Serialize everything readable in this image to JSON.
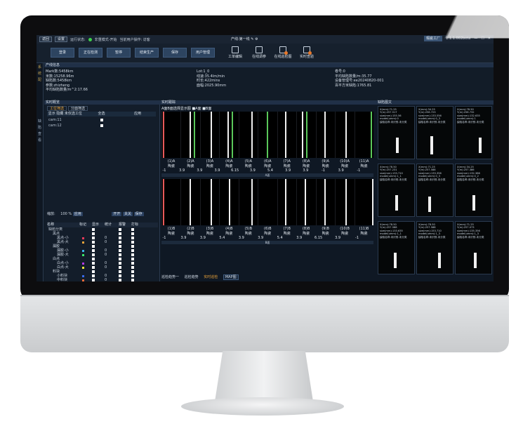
{
  "titlebar": {
    "btn_return": "返回",
    "btn_settings": "设置",
    "run_status_label": "运行状态:",
    "run_status_value": "非重模式-开始",
    "current_user": "当前用户操作: 访客",
    "line_name": "产线:第一线",
    "app_badge": "瑕疵工厂",
    "version": "1.1.1.002beta",
    "status_color": "#3ecf4a"
  },
  "toolbar": {
    "buttons": [
      "登录",
      "正在检测",
      "暂停",
      "结束生产",
      "保存",
      "用户管理"
    ],
    "icons": [
      {
        "label": "工单编辑",
        "icon": "edit-icon"
      },
      {
        "label": "在线调参",
        "icon": "list-icon"
      },
      {
        "label": "在线巡检图",
        "icon": "inspect-icon"
      },
      {
        "label": "实时查验",
        "icon": "check-icon"
      }
    ]
  },
  "leftstrip": {
    "top": [
      "系",
      "统",
      "配"
    ],
    "bottom": [
      "缺",
      "陷",
      "查",
      "看"
    ]
  },
  "product_info": {
    "title": "产线信息",
    "col1": [
      "Mark数:5458km",
      "米数:15258.96m",
      "缺陷数:5458km",
      "参数:zhizheng",
      "平均缺陷数量/m^2:17.66"
    ],
    "col2": [
      "Lot:1_0",
      "线速:35.4lm/min",
      "时长:422mins",
      "面幅:2025.90mm"
    ],
    "col3": [
      "卷号:0",
      "平均缺陷数量/m:35.77",
      "设备管理号:ee20240820-001",
      "百平方米缺陷:1765.81"
    ]
  },
  "overview": {
    "title": "实时概览",
    "tabs": [
      "工位筛选",
      "分面筛选"
    ],
    "sub_headers": [
      "显示 隐藏 未仅选工位",
      "全选",
      "应用"
    ],
    "rows": [
      "cam:11",
      "cam:12"
    ],
    "scale_label": "缩放:",
    "scale_value": "100",
    "scale_pct": "%",
    "apply": "应用",
    "actions": [
      "开开",
      "关关",
      "保存"
    ],
    "table_headers": [
      "名称",
      "标记",
      "显示",
      "统计",
      "报警",
      "打标"
    ],
    "table_rows": [
      {
        "name": "缺陷分类",
        "indent": 0,
        "mark": "",
        "count": ""
      },
      {
        "name": "黑点",
        "indent": 1,
        "mark": "",
        "count": ""
      },
      {
        "name": "黑点-小",
        "indent": 2,
        "mark": "#e83a5a",
        "count": "0"
      },
      {
        "name": "黑点-大",
        "indent": 2,
        "mark": "#e8a23a",
        "count": "0"
      },
      {
        "name": "漏胶",
        "indent": 1,
        "mark": "",
        "count": ""
      },
      {
        "name": "漏胶-小",
        "indent": 2,
        "mark": "#3ab0e8",
        "count": "0"
      },
      {
        "name": "漏胶-大",
        "indent": 2,
        "mark": "#3ae86a",
        "count": "0"
      },
      {
        "name": "白点",
        "indent": 1,
        "mark": "",
        "count": ""
      },
      {
        "name": "白点-小",
        "indent": 2,
        "mark": "#b03ae8",
        "count": "0"
      },
      {
        "name": "白点-大",
        "indent": 2,
        "mark": "#e8e83a",
        "count": "0"
      },
      {
        "name": "料块",
        "indent": 1,
        "mark": "",
        "count": ""
      },
      {
        "name": "小料块",
        "indent": 2,
        "mark": "#3a6ae8",
        "count": "0"
      },
      {
        "name": "中料块",
        "indent": 2,
        "mark": "#e86a3a",
        "count": "0"
      },
      {
        "name": "大料块",
        "indent": 2,
        "mark": "#6ae8d0",
        "count": "0"
      },
      {
        "name": "毛发",
        "indent": 1,
        "mark": "",
        "count": ""
      },
      {
        "name": "毛发",
        "indent": 2,
        "mark": "#d0d0d0",
        "count": "0"
      },
      {
        "name": "异物",
        "indent": 1,
        "mark": "",
        "count": ""
      },
      {
        "name": "异物",
        "indent": 2,
        "mark": "#e83ad0",
        "count": "0"
      },
      {
        "name": "破洞",
        "indent": 1,
        "mark": "",
        "count": ""
      },
      {
        "name": "破洞-小",
        "indent": 2,
        "mark": "#3ae8b0",
        "count": "0"
      },
      {
        "name": "破洞-中",
        "indent": 2,
        "mark": "#e8c03a",
        "count": "0"
      },
      {
        "name": "破洞-大",
        "indent": 2,
        "mark": "#8a3ae8",
        "count": "0"
      },
      {
        "name": "晶点",
        "indent": 1,
        "mark": "",
        "count": ""
      },
      {
        "name": "晶点-小",
        "indent": 2,
        "mark": "#3ae8e8",
        "count": "0"
      },
      {
        "name": "晶点-中",
        "indent": 2,
        "mark": "#e83a3a",
        "count": "0"
      },
      {
        "name": "晶点-大",
        "indent": 2,
        "mark": "#a0e83a",
        "count": "0"
      }
    ]
  },
  "tracking": {
    "title": "实时跟踪",
    "legend": "A面B面选择显示图 ■A面 ■B面",
    "lane_a_labels": [
      "(1)A",
      "(2)A",
      "(3)A",
      "(4)A",
      "(5)A",
      "(6)A",
      "(7)A",
      "(8)A",
      "(9)A",
      "(10)A",
      "(11)A"
    ],
    "lane_b_labels": [
      "(1)B",
      "(2)B",
      "(3)B",
      "(4)B",
      "(5)B",
      "(6)B",
      "(7)B",
      "(8)B",
      "(9)B",
      "(10)B",
      "(11)B"
    ],
    "lane_word": "陶瓷",
    "a_values": [
      "-1",
      "3.9",
      "3.9",
      "3.9",
      "6.15",
      "3.9",
      "5.4",
      "3.9",
      "3.9",
      "-1",
      "3.9",
      "-1"
    ],
    "b_values": [
      "-1",
      "3.9",
      "3.9",
      "5.4",
      "3.9",
      "3.9",
      "5.4",
      "3.9",
      "6.15",
      "3.9",
      "-1"
    ],
    "sep_a": "A面",
    "sep_b": "B面",
    "bottom_tabs": [
      "巡检趋势一",
      "巡检趋势",
      "实时巡检",
      "MAP图"
    ]
  },
  "defects": {
    "title": "缺陷图文",
    "cards": [
      [
        "X(mm):71.25",
        "Y(m):257.517",
        "size(mm):155.56",
        "model(umm):0",
        "缺陷名称:未识别-未分类"
      ],
      [
        "X(mm):34.25",
        "Y(m):256.723",
        "size(mm):133.556",
        "model(umm):0_3",
        "缺陷名称:未识别-未分类"
      ],
      [
        "X(mm):78.50",
        "Y(m):256.732",
        "size(mm):132.635",
        "model(umm):1",
        "缺陷名称:未识别-未分类"
      ],
      [
        "X(mm):78.50",
        "Y(m):257.231",
        "size(mm):133.710",
        "model(umm):1_1",
        "缺陷名称:未识别-未分类"
      ],
      [
        "X(mm):71.25",
        "Y(m):257.588",
        "size(mm):133.356",
        "model(umm):0_3",
        "缺陷名称:未识别-未分类"
      ],
      [
        "X(mm):34.25",
        "Y(m):257.386",
        "size(mm):132.386",
        "model(umm):0_2",
        "缺陷名称:未识别-未分类"
      ],
      [
        "X(mm):78.50",
        "Y(m):257.588",
        "size(mm):133.635",
        "model(umm):1_1",
        "缺陷名称:未识别-未分类"
      ],
      [
        "X(mm):78.50",
        "Y(m):257.588",
        "size(mm):153.710",
        "model(umm):1_3",
        "缺陷名称:未识别-未分类"
      ],
      [
        "X(mm):71.25",
        "Y(m):257.073",
        "size(mm):135.356",
        "model(umm):1_3",
        "缺陷名称:未识别-未分类"
      ]
    ]
  }
}
